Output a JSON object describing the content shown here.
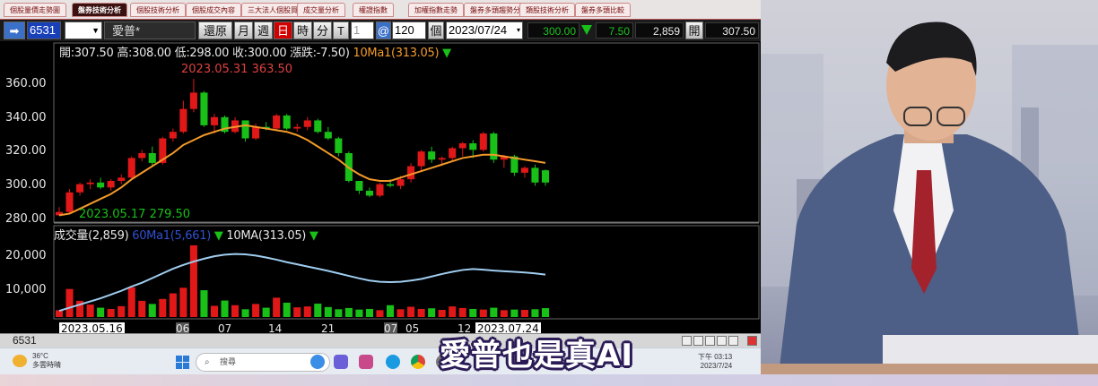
{
  "tabs": [
    "個股量價走勢圖",
    "盤券技術分析",
    "個股技術分析",
    "個股成交內容",
    "三大法人個股買賣狀況",
    "成交量分析",
    "權證指數",
    "加權指數走勢",
    "盤券多頭趨勢分析",
    "類股技術分析",
    "盤券多頭比較"
  ],
  "toolbar": {
    "stock_code": "6531",
    "stock_name": "愛普*",
    "restore": "還原",
    "periods": [
      "月",
      "週",
      "日",
      "時",
      "分",
      "T"
    ],
    "count_value": "1",
    "at_symbol": "@",
    "bars": "120",
    "bars_unit": "個",
    "date": "2023/07/24",
    "price": "300.00",
    "change": "7.50",
    "volume": "2,859",
    "open_label": "開",
    "open_value": "307.50"
  },
  "chart_info": {
    "open": "開:307.50",
    "high": "高:308.00",
    "low": "低:298.00",
    "close": "收:300.00",
    "change": "漲跌:-7.50)",
    "ma": "10Ma1(313.05)",
    "high_note": "2023.05.31  363.50",
    "low_note": "2023.05.17  279.50",
    "vol_label": "成交量(2,859)",
    "vol_ma60": "60Ma1(5,661)",
    "vol_ma10": "10MA(313.05)"
  },
  "chart_data": [
    {
      "type": "candlestick",
      "title": "",
      "yticks": [
        "360.00",
        "340.00",
        "320.00",
        "300.00",
        "280.00"
      ],
      "ylim": [
        278,
        370
      ],
      "xticks": [
        "2023.05.16",
        "06",
        "07",
        "14",
        "21",
        "07",
        "05",
        "12",
        "2023.07.24"
      ],
      "ohlc": [
        [
          280,
          285,
          279.5,
          282
        ],
        [
          282,
          296,
          281,
          294
        ],
        [
          294,
          300,
          292,
          299
        ],
        [
          299,
          302,
          296,
          300
        ],
        [
          300,
          303,
          296,
          297
        ],
        [
          297,
          302,
          295,
          301
        ],
        [
          301,
          305,
          299,
          303
        ],
        [
          303,
          316,
          302,
          315
        ],
        [
          315,
          320,
          313,
          318
        ],
        [
          318,
          322,
          310,
          312
        ],
        [
          312,
          328,
          311,
          327
        ],
        [
          327,
          333,
          325,
          331
        ],
        [
          331,
          350,
          330,
          345
        ],
        [
          345,
          363.5,
          343,
          355
        ],
        [
          355,
          356,
          334,
          335
        ],
        [
          335,
          342,
          330,
          340
        ],
        [
          340,
          341,
          330,
          331
        ],
        [
          331,
          340,
          330,
          338
        ],
        [
          338,
          338,
          325,
          327
        ],
        [
          327,
          336,
          326,
          334
        ],
        [
          334,
          337,
          332,
          333
        ],
        [
          333,
          342,
          332,
          341
        ],
        [
          341,
          342,
          332,
          333
        ],
        [
          333,
          336,
          331,
          334
        ],
        [
          334,
          340,
          332,
          338
        ],
        [
          338,
          339,
          330,
          331
        ],
        [
          331,
          334,
          326,
          327
        ],
        [
          327,
          328,
          316,
          318
        ],
        [
          318,
          319,
          300,
          301
        ],
        [
          301,
          301,
          293,
          295
        ],
        [
          295,
          297,
          291,
          292
        ],
        [
          292,
          300,
          291,
          299
        ],
        [
          299,
          302,
          297,
          298
        ],
        [
          298,
          304,
          296,
          302
        ],
        [
          302,
          312,
          300,
          310
        ],
        [
          310,
          320,
          307,
          319
        ],
        [
          319,
          322,
          312,
          314
        ],
        [
          314,
          316,
          310,
          315
        ],
        [
          315,
          322,
          313,
          321
        ],
        [
          321,
          325,
          316,
          324
        ],
        [
          324,
          326,
          315,
          320
        ],
        [
          320,
          331,
          319,
          330
        ],
        [
          330,
          331,
          312,
          314
        ],
        [
          314,
          317,
          309,
          316
        ],
        [
          316,
          317,
          304,
          306
        ],
        [
          306,
          310,
          303,
          309
        ],
        [
          309,
          311,
          298,
          300
        ],
        [
          307.5,
          308,
          298,
          300
        ]
      ],
      "ma10": [
        280,
        281,
        284,
        287,
        290,
        293,
        297,
        302,
        306,
        310,
        314,
        318,
        323,
        326,
        329,
        331,
        333,
        334,
        335,
        334,
        333,
        332,
        331,
        329,
        326,
        322,
        318,
        314,
        309,
        305,
        302,
        301,
        301,
        303,
        305,
        307,
        309,
        311,
        313,
        315,
        316,
        317,
        317,
        316,
        315,
        314,
        313.05,
        312
      ]
    },
    {
      "type": "bar",
      "title": "",
      "yticks": [
        "20,000",
        "10,000"
      ],
      "ylim": [
        0,
        27000
      ],
      "volumes": [
        2200,
        9000,
        5200,
        4000,
        3000,
        2600,
        3500,
        9500,
        5200,
        4200,
        5800,
        7600,
        9400,
        23000,
        8600,
        3600,
        5300,
        3800,
        2500,
        4200,
        3000,
        6200,
        4600,
        3100,
        3400,
        4300,
        3200,
        2500,
        2900,
        2400,
        2600,
        2200,
        3800,
        2500,
        3300,
        2600,
        2800,
        2300,
        3400,
        2900,
        2600,
        2400,
        3000,
        2200,
        2400,
        2300,
        2500,
        2859
      ],
      "ma60": [
        2000,
        3000,
        4000,
        5000,
        6000,
        7200,
        8400,
        9800,
        11000,
        12500,
        14000,
        15500,
        16700,
        17800,
        18700,
        19500,
        20000,
        20200,
        20100,
        19700,
        19100,
        18400,
        17600,
        16900,
        16200,
        15500,
        14800,
        14000,
        13200,
        12400,
        11700,
        11300,
        11200,
        11300,
        11700,
        12200,
        13000,
        13800,
        14500,
        15100,
        15400,
        15200,
        14900,
        14700,
        14500,
        14300,
        14000,
        13600
      ]
    }
  ],
  "status": {
    "code": "6531"
  },
  "taskbar": {
    "weather_temp": "36°C",
    "weather_desc": "多雲時晴",
    "search": "搜尋",
    "time": "下午 03:13",
    "date": "2023/7/24"
  },
  "subtitle": "愛普也是真AI",
  "colors": {
    "up": "#e01818",
    "down": "#18c018",
    "ma": "#f29a2a",
    "vol_ma": "#9fcdf0",
    "bg": "#000000"
  }
}
